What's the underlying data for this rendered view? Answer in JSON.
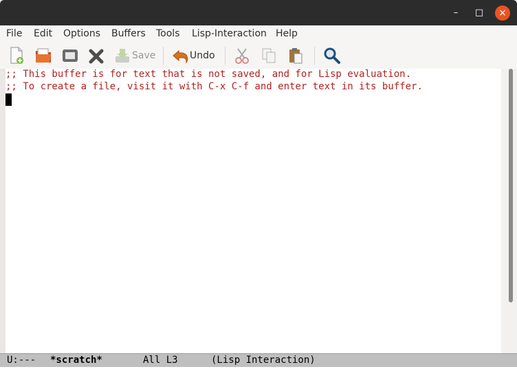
{
  "window": {
    "controls": {
      "minimize": "–",
      "maximize": "□",
      "close": "×"
    }
  },
  "menubar": {
    "items": [
      "File",
      "Edit",
      "Options",
      "Buffers",
      "Tools",
      "Lisp-Interaction",
      "Help"
    ]
  },
  "toolbar": {
    "buttons": [
      {
        "icon": "new-file-icon",
        "label": ""
      },
      {
        "icon": "open-folder-icon",
        "label": ""
      },
      {
        "icon": "dired-icon",
        "label": ""
      },
      {
        "icon": "close-buffer-icon",
        "label": ""
      },
      {
        "icon": "save-icon",
        "label": "Save"
      },
      {
        "icon": "undo-icon",
        "label": "Undo"
      },
      {
        "icon": "cut-icon",
        "label": ""
      },
      {
        "icon": "copy-icon",
        "label": ""
      },
      {
        "icon": "paste-icon",
        "label": ""
      },
      {
        "icon": "search-icon",
        "label": ""
      }
    ]
  },
  "editor": {
    "lines": [
      ";; This buffer is for text that is not saved, and for Lisp evaluation.",
      ";; To create a file, visit it with C-x C-f and enter text in its buffer."
    ],
    "comment_color": "#b22222"
  },
  "modeline": {
    "status": "U:---",
    "buffer_name": "*scratch*",
    "position": "All L3",
    "mode": "(Lisp Interaction)"
  },
  "colors": {
    "titlebar": "#2c2c2c",
    "close_button": "#e95420",
    "modeline": "#bfbfbf"
  }
}
